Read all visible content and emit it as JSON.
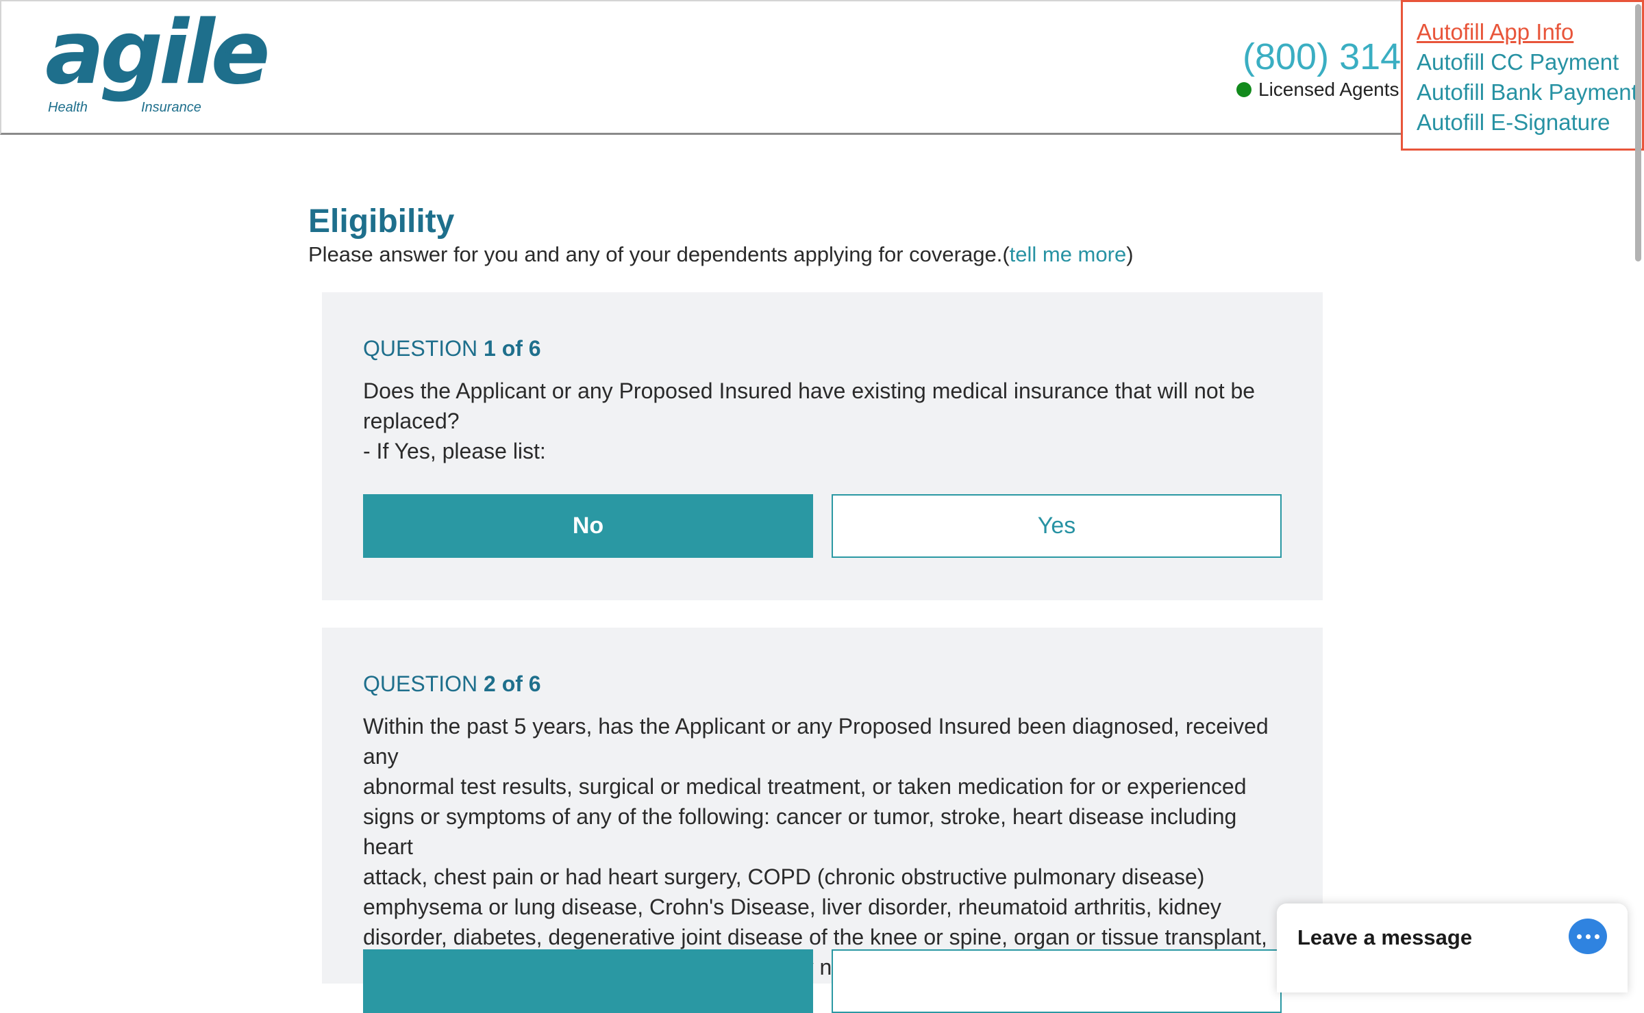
{
  "header": {
    "logo": {
      "word": "agile",
      "sub_left": "Health",
      "sub_right": "Insurance",
      "reg": "®"
    },
    "phone": "(800) 314-",
    "agents_label": "Licensed Agents"
  },
  "autofill": {
    "items": [
      {
        "label": "Autofill App Info",
        "active": true
      },
      {
        "label": "Autofill CC Payment"
      },
      {
        "label": "Autofill Bank Payment"
      },
      {
        "label": "Autofill E-Signature"
      }
    ]
  },
  "main": {
    "title": "Eligibility",
    "subtitle": "Please answer for you and any of your dependents applying for coverage.(",
    "subtitle_link": "tell me more",
    "subtitle_end": ")",
    "questions": [
      {
        "prefix": "QUESTION ",
        "number": "1 of 6",
        "text_lines": [
          "Does the Applicant or any Proposed Insured have existing medical insurance that will not be",
          "replaced?",
          "- If Yes, please list:"
        ],
        "no_label": "No",
        "yes_label": "Yes",
        "selected": "No"
      },
      {
        "prefix": "QUESTION ",
        "number": "2 of 6",
        "text_lines": [
          "Within the past 5 years, has the Applicant or any Proposed Insured been diagnosed, received any",
          "abnormal test results, surgical or medical treatment, or taken medication for or experienced",
          "signs or symptoms of any of the following: cancer or tumor, stroke, heart disease including heart",
          "attack, chest pain or had heart surgery, COPD (chronic obstructive pulmonary disease)",
          "emphysema or lung disease, Crohn's Disease, liver disorder, rheumatoid arthritis, kidney",
          "disorder, diabetes, degenerative joint disease of the knee or spine, organ or tissue transplant,",
          "alcohol abuse or chemical dependency, or any neurological disorder?"
        ]
      }
    ]
  },
  "chat": {
    "label": "Leave a message"
  },
  "colors": {
    "brand": "#1e6f8c",
    "accent": "#2a98a3",
    "autofill_border": "#e8553a",
    "online": "#128a1c",
    "chat_icon": "#2f83e0"
  }
}
